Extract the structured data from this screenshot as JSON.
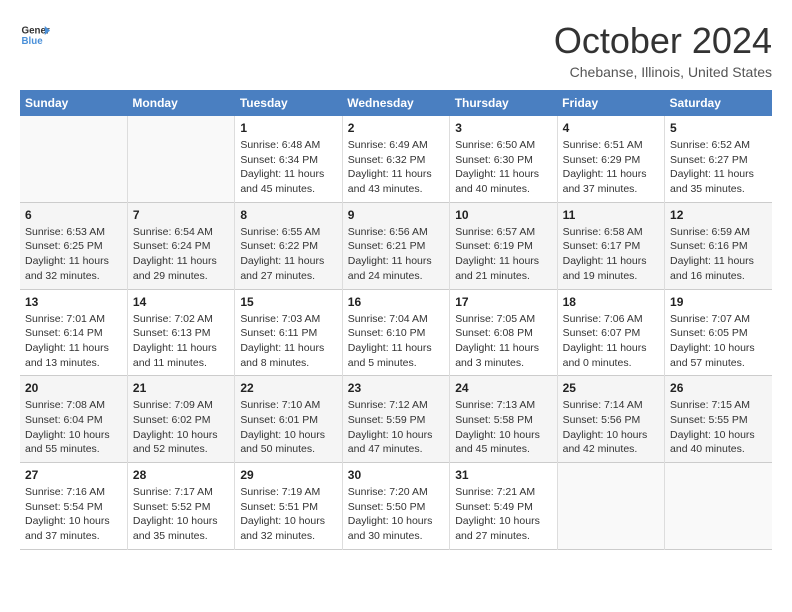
{
  "logo": {
    "line1": "General",
    "line2": "Blue"
  },
  "title": "October 2024",
  "location": "Chebanse, Illinois, United States",
  "weekdays": [
    "Sunday",
    "Monday",
    "Tuesday",
    "Wednesday",
    "Thursday",
    "Friday",
    "Saturday"
  ],
  "weeks": [
    [
      {
        "day": "",
        "info": ""
      },
      {
        "day": "",
        "info": ""
      },
      {
        "day": "1",
        "info": "Sunrise: 6:48 AM\nSunset: 6:34 PM\nDaylight: 11 hours and 45 minutes."
      },
      {
        "day": "2",
        "info": "Sunrise: 6:49 AM\nSunset: 6:32 PM\nDaylight: 11 hours and 43 minutes."
      },
      {
        "day": "3",
        "info": "Sunrise: 6:50 AM\nSunset: 6:30 PM\nDaylight: 11 hours and 40 minutes."
      },
      {
        "day": "4",
        "info": "Sunrise: 6:51 AM\nSunset: 6:29 PM\nDaylight: 11 hours and 37 minutes."
      },
      {
        "day": "5",
        "info": "Sunrise: 6:52 AM\nSunset: 6:27 PM\nDaylight: 11 hours and 35 minutes."
      }
    ],
    [
      {
        "day": "6",
        "info": "Sunrise: 6:53 AM\nSunset: 6:25 PM\nDaylight: 11 hours and 32 minutes."
      },
      {
        "day": "7",
        "info": "Sunrise: 6:54 AM\nSunset: 6:24 PM\nDaylight: 11 hours and 29 minutes."
      },
      {
        "day": "8",
        "info": "Sunrise: 6:55 AM\nSunset: 6:22 PM\nDaylight: 11 hours and 27 minutes."
      },
      {
        "day": "9",
        "info": "Sunrise: 6:56 AM\nSunset: 6:21 PM\nDaylight: 11 hours and 24 minutes."
      },
      {
        "day": "10",
        "info": "Sunrise: 6:57 AM\nSunset: 6:19 PM\nDaylight: 11 hours and 21 minutes."
      },
      {
        "day": "11",
        "info": "Sunrise: 6:58 AM\nSunset: 6:17 PM\nDaylight: 11 hours and 19 minutes."
      },
      {
        "day": "12",
        "info": "Sunrise: 6:59 AM\nSunset: 6:16 PM\nDaylight: 11 hours and 16 minutes."
      }
    ],
    [
      {
        "day": "13",
        "info": "Sunrise: 7:01 AM\nSunset: 6:14 PM\nDaylight: 11 hours and 13 minutes."
      },
      {
        "day": "14",
        "info": "Sunrise: 7:02 AM\nSunset: 6:13 PM\nDaylight: 11 hours and 11 minutes."
      },
      {
        "day": "15",
        "info": "Sunrise: 7:03 AM\nSunset: 6:11 PM\nDaylight: 11 hours and 8 minutes."
      },
      {
        "day": "16",
        "info": "Sunrise: 7:04 AM\nSunset: 6:10 PM\nDaylight: 11 hours and 5 minutes."
      },
      {
        "day": "17",
        "info": "Sunrise: 7:05 AM\nSunset: 6:08 PM\nDaylight: 11 hours and 3 minutes."
      },
      {
        "day": "18",
        "info": "Sunrise: 7:06 AM\nSunset: 6:07 PM\nDaylight: 11 hours and 0 minutes."
      },
      {
        "day": "19",
        "info": "Sunrise: 7:07 AM\nSunset: 6:05 PM\nDaylight: 10 hours and 57 minutes."
      }
    ],
    [
      {
        "day": "20",
        "info": "Sunrise: 7:08 AM\nSunset: 6:04 PM\nDaylight: 10 hours and 55 minutes."
      },
      {
        "day": "21",
        "info": "Sunrise: 7:09 AM\nSunset: 6:02 PM\nDaylight: 10 hours and 52 minutes."
      },
      {
        "day": "22",
        "info": "Sunrise: 7:10 AM\nSunset: 6:01 PM\nDaylight: 10 hours and 50 minutes."
      },
      {
        "day": "23",
        "info": "Sunrise: 7:12 AM\nSunset: 5:59 PM\nDaylight: 10 hours and 47 minutes."
      },
      {
        "day": "24",
        "info": "Sunrise: 7:13 AM\nSunset: 5:58 PM\nDaylight: 10 hours and 45 minutes."
      },
      {
        "day": "25",
        "info": "Sunrise: 7:14 AM\nSunset: 5:56 PM\nDaylight: 10 hours and 42 minutes."
      },
      {
        "day": "26",
        "info": "Sunrise: 7:15 AM\nSunset: 5:55 PM\nDaylight: 10 hours and 40 minutes."
      }
    ],
    [
      {
        "day": "27",
        "info": "Sunrise: 7:16 AM\nSunset: 5:54 PM\nDaylight: 10 hours and 37 minutes."
      },
      {
        "day": "28",
        "info": "Sunrise: 7:17 AM\nSunset: 5:52 PM\nDaylight: 10 hours and 35 minutes."
      },
      {
        "day": "29",
        "info": "Sunrise: 7:19 AM\nSunset: 5:51 PM\nDaylight: 10 hours and 32 minutes."
      },
      {
        "day": "30",
        "info": "Sunrise: 7:20 AM\nSunset: 5:50 PM\nDaylight: 10 hours and 30 minutes."
      },
      {
        "day": "31",
        "info": "Sunrise: 7:21 AM\nSunset: 5:49 PM\nDaylight: 10 hours and 27 minutes."
      },
      {
        "day": "",
        "info": ""
      },
      {
        "day": "",
        "info": ""
      }
    ]
  ]
}
